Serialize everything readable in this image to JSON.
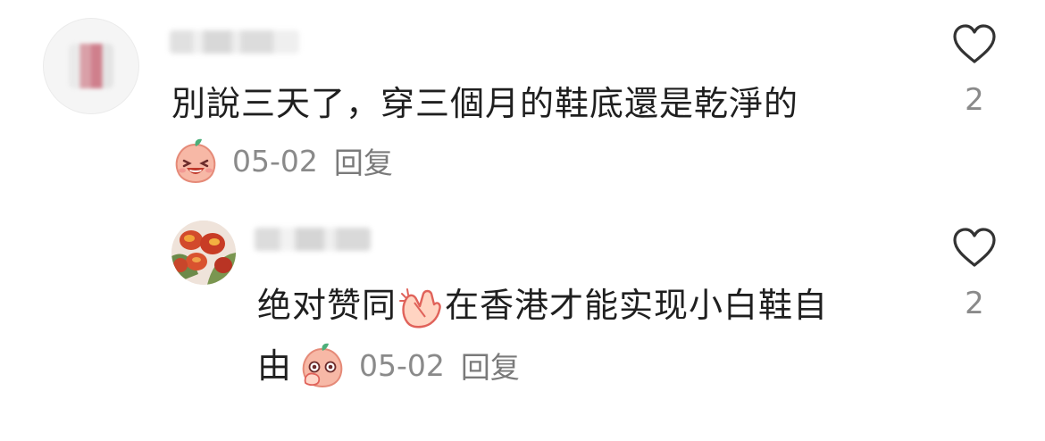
{
  "comments": [
    {
      "text": "別說三天了，穿三個月的鞋底還是乾淨的",
      "date": "05-02",
      "reply_label": "回复",
      "like_count": "2",
      "emoji": "laughing-peach-icon"
    },
    {
      "text_part1": "绝对赞同",
      "text_part2": "在香港才能实现小白鞋自",
      "text_line2": "由",
      "date": "05-02",
      "reply_label": "回复",
      "like_count": "2",
      "inline_emoji": "clapping-hands-icon",
      "emoji": "covering-mouth-peach-icon"
    }
  ],
  "colors": {
    "text": "#1f1f1f",
    "meta": "#8a8a8a",
    "heart_stroke": "#333333",
    "peach": "#f7b8a6",
    "peach_leaf": "#4caf7a"
  }
}
